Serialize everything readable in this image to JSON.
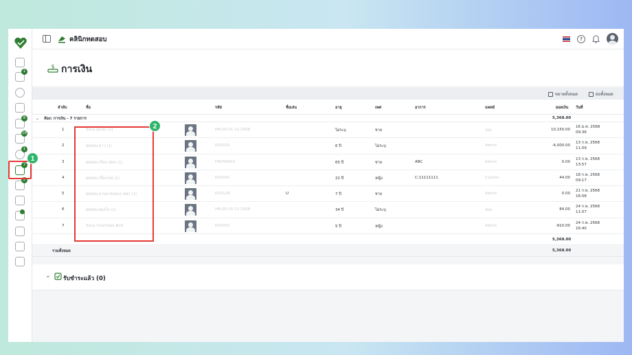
{
  "app": {
    "brand": "คลินิกทดสอบ",
    "language_flag": "th-flag-icon",
    "colors": {
      "accent": "#2e7d32",
      "highlight": "#e53935",
      "step_badge": "#2eb46b"
    }
  },
  "sidebar": {
    "items": [
      {
        "icon": "home-icon",
        "badge": ""
      },
      {
        "icon": "clipboard-icon",
        "badge": "1"
      },
      {
        "icon": "user-icon",
        "badge": ""
      },
      {
        "icon": "calendar-icon",
        "badge": ""
      },
      {
        "icon": "queue-icon",
        "badge": "8"
      },
      {
        "icon": "pharmacy-icon",
        "badge": "18"
      },
      {
        "icon": "patient-icon",
        "badge": "1"
      },
      {
        "icon": "cashier-icon",
        "badge": "7",
        "active": true
      },
      {
        "icon": "tools-icon",
        "badge": "2"
      },
      {
        "icon": "percent-icon",
        "badge": ""
      },
      {
        "icon": "lab-icon",
        "badge": ""
      },
      {
        "icon": "grid-icon",
        "badge": ""
      },
      {
        "icon": "chart-icon",
        "badge": ""
      },
      {
        "icon": "gear-icon",
        "badge": ""
      }
    ]
  },
  "steps": {
    "one": "1",
    "two": "2"
  },
  "page": {
    "title": "การเงิน"
  },
  "toolbar": {
    "expand_all": "ขยายทั้งหมด",
    "collapse_all": "ย่อทั้งหมด"
  },
  "table": {
    "headers": {
      "no": "ลำดับ",
      "name": "ชื่อ",
      "code": "รหัส",
      "nickname": "ชื่อเล่น",
      "age": "อายุ",
      "sex": "เพศ",
      "symptom": "อาการ",
      "doctor": "แพทย์",
      "amount": "ยอดเงิน",
      "date": "วันที่"
    },
    "group": {
      "label": "ห้อง: การเงิน - 7 รายการ",
      "total": "5,368.00"
    },
    "rows": [
      {
        "no": "1",
        "name": "Sony Jones (1)",
        "code": "HN-00-01-11-2568",
        "nickname": "",
        "age": "ไม่ระบุ",
        "sex": "ชาย",
        "symptom": "",
        "doctor": "ปอง",
        "amount": "10,150.00",
        "date": "16 ม.ค. 2568",
        "time": "09:36"
      },
      {
        "no": "2",
        "name": "ผสมผน ดาว (1)",
        "code": "RX0015",
        "nickname": "",
        "age": "6 ปี",
        "sex": "ไม่ระบุ",
        "symptom": "",
        "doctor": "Admin",
        "amount": "-4,000.00",
        "date": "13 ก.พ. 2568",
        "time": "11:09"
      },
      {
        "no": "3",
        "name": "ผสมผน เรือน (ทด) (1)",
        "code": "HN250002",
        "nickname": "",
        "age": "65 ปี",
        "sex": "ชาย",
        "symptom": "ABC",
        "doctor": "Admin",
        "amount": "0.00",
        "date": "13 ก.พ. 2568",
        "time": "13:57"
      },
      {
        "no": "4",
        "name": "ผสมผน เปิ้ลภรณ์ (1)",
        "code": "RX0041",
        "nickname": "",
        "age": "22 ปี",
        "sex": "หญิง",
        "symptom": "C:11111111",
        "doctor": "Cashier",
        "amount": "44.00",
        "date": "18 ก.พ. 2568",
        "time": "09:17"
      },
      {
        "no": "5",
        "name": "ผสมผน มานพ ทดลอง (ทด) (1)",
        "code": "RX0128",
        "nickname": "U",
        "age": "7 ปี",
        "sex": "ชาย",
        "symptom": "",
        "doctor": "Admin",
        "amount": "0.00",
        "date": "21 ก.พ. 2568",
        "time": "16:08"
      },
      {
        "no": "6",
        "name": "ผสมผน ผดุงใจ (1)",
        "code": "HN-00-15-11-2568",
        "nickname": "",
        "age": "34 ปี",
        "sex": "ไม่ระบุ",
        "symptom": "",
        "doctor": "หมอ",
        "amount": "84.00",
        "date": "24 ก.พ. 2568",
        "time": "11:07"
      },
      {
        "no": "7",
        "name": "Sony Chambee Bird",
        "code": "RX0002",
        "nickname": "",
        "age": "5 ปี",
        "sex": "หญิง",
        "symptom": "",
        "doctor": "Admin",
        "amount": "-910.00",
        "date": "24 ก.พ. 2568",
        "time": "16:40"
      }
    ],
    "subtotal": "5,368.00",
    "grand_total_label": "รวมทั้งหมด",
    "grand_total": "5,368.00"
  },
  "paid": {
    "label": "รับชำระแล้ว (0)"
  }
}
